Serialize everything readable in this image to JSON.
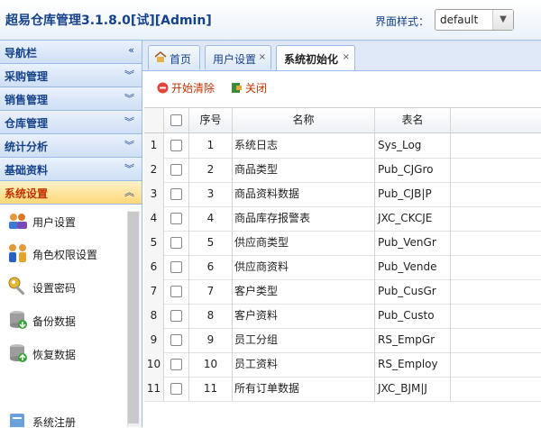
{
  "header": {
    "title": "超易仓库管理3.1.8.0[试][Admin]",
    "theme_label": "界面样式：",
    "theme_value": "default"
  },
  "sidebar": {
    "title": "导航栏",
    "sections": [
      {
        "label": "采购管理"
      },
      {
        "label": "销售管理"
      },
      {
        "label": "仓库管理"
      },
      {
        "label": "统计分析"
      },
      {
        "label": "基础资料"
      },
      {
        "label": "系统设置"
      }
    ],
    "items": [
      {
        "label": "用户设置",
        "icon": "users-icon"
      },
      {
        "label": "角色权限设置",
        "icon": "role-permission-icon"
      },
      {
        "label": "设置密码",
        "icon": "key-icon"
      },
      {
        "label": "备份数据",
        "icon": "database-backup-icon"
      },
      {
        "label": "恢复数据",
        "icon": "database-restore-icon"
      },
      {
        "label": "系统注册",
        "icon": "register-icon"
      }
    ]
  },
  "tabs": [
    {
      "label": "首页",
      "icon": "home-icon"
    },
    {
      "label": "用户设置",
      "close": "×"
    },
    {
      "label": "系统初始化",
      "close": "×"
    }
  ],
  "toolbar": {
    "clear_label": "开始清除",
    "close_label": "关闭"
  },
  "grid": {
    "columns": [
      "序号",
      "名称",
      "表名"
    ],
    "rows": [
      {
        "rn": "1",
        "no": "1",
        "name": "系统日志",
        "table": "Sys_Log"
      },
      {
        "rn": "2",
        "no": "2",
        "name": "商品类型",
        "table": "Pub_CJGro"
      },
      {
        "rn": "3",
        "no": "3",
        "name": "商品资料数据",
        "table": "Pub_CJB|P"
      },
      {
        "rn": "4",
        "no": "4",
        "name": "商品库存报警表",
        "table": "JXC_CKCJE"
      },
      {
        "rn": "5",
        "no": "5",
        "name": "供应商类型",
        "table": "Pub_VenGr"
      },
      {
        "rn": "6",
        "no": "6",
        "name": "供应商资料",
        "table": "Pub_Vende"
      },
      {
        "rn": "7",
        "no": "7",
        "name": "客户类型",
        "table": "Pub_CusGr"
      },
      {
        "rn": "8",
        "no": "8",
        "name": "客户资料",
        "table": "Pub_Custo"
      },
      {
        "rn": "9",
        "no": "9",
        "name": "员工分组",
        "table": "RS_EmpGr"
      },
      {
        "rn": "10",
        "no": "10",
        "name": "员工资料",
        "table": "RS_Employ"
      },
      {
        "rn": "11",
        "no": "11",
        "name": "所有订单数据",
        "table": "JXC_BJM|J"
      }
    ]
  },
  "colors": {
    "header_text": "#15428b",
    "active_section": "#ffd87a",
    "accent_red": "#c23300"
  }
}
